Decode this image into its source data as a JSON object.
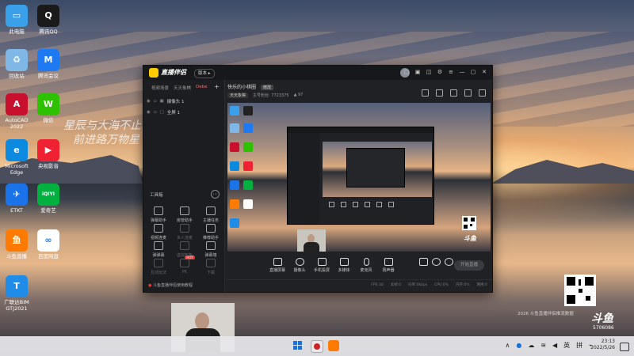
{
  "desktop": {
    "icons": [
      {
        "label": "此电脑",
        "glyph": "▭",
        "color": "#3aa0ea"
      },
      {
        "label": "腾讯QQ",
        "glyph": "Q",
        "color": "#1a1a1a"
      },
      {
        "label": "回收站",
        "glyph": "♻",
        "color": "#7fb8e6"
      },
      {
        "label": "腾讯会议",
        "glyph": "M",
        "color": "#1e7af2"
      },
      {
        "label": "AutoCAD 2022",
        "glyph": "A",
        "color": "#c8102e"
      },
      {
        "label": "微信",
        "glyph": "W",
        "color": "#2dc100"
      },
      {
        "label": "Microsoft Edge",
        "glyph": "e",
        "color": "#0c8adf"
      },
      {
        "label": "央视影音",
        "glyph": "▶",
        "color": "#e23"
      },
      {
        "label": "ETKT",
        "glyph": "✈",
        "color": "#1a73e8"
      },
      {
        "label": "爱奇艺",
        "glyph": "iQIYI",
        "color": "#00b140"
      },
      {
        "label": "斗鱼直播",
        "glyph": "鱼",
        "color": "#ff7a00"
      },
      {
        "label": "百度网盘",
        "glyph": "∞",
        "color": "#ffffff"
      },
      {
        "label": "广联达BIM GTJ2021",
        "glyph": "T",
        "color": "#1f8de8"
      }
    ],
    "handwriting": [
      "星辰与大海不止，",
      "前进路万物星"
    ],
    "watermark": "2026 斗鱼直播伴侣推流数据",
    "room_number": "5706086",
    "brand": "斗鱼"
  },
  "app": {
    "title": "直播伴侣",
    "version_button": "版本 ▸",
    "left_tabs": [
      "视频场景",
      "天天象棋",
      "Debe"
    ],
    "scenes": [
      "摄像头 1",
      "全屏 1"
    ],
    "tools_heading": "工具箱",
    "tools": [
      {
        "label": "弹幕助手",
        "dim": false
      },
      {
        "label": "房管助手",
        "dim": false
      },
      {
        "label": "主播任务",
        "dim": false
      },
      {
        "label": "视频连麦",
        "dim": false
      },
      {
        "label": "多人连麦",
        "dim": true
      },
      {
        "label": "推荐助手",
        "dim": false
      },
      {
        "label": "弹弹幕",
        "dim": false
      },
      {
        "label": "虚拟形象",
        "dim": true
      },
      {
        "label": "弹幕墙",
        "dim": false
      },
      {
        "label": "互动玩法",
        "dim": true
      },
      {
        "label": "PK",
        "dim": true,
        "badge": "HOT"
      },
      {
        "label": "下载",
        "dim": true
      }
    ],
    "left_footer": "斗鱼直播伴侣使用教程",
    "room_title": "快乐的小棋圈",
    "room_badge": "修改",
    "room_category": "天天象棋",
    "room_id_label": "主号粉丝: 7723375",
    "room_heat": "▲ 97",
    "bottom_tools": [
      "直播屏幕",
      "摄像头",
      "手机投屏",
      "多媒体",
      "麦克风",
      "扬声器"
    ],
    "start_button": "开始直播",
    "status_items": [
      "FPS:30",
      "丢帧:0",
      "码率:0kbps",
      "CPU:0%",
      "内存:0%",
      "网络:0"
    ]
  },
  "taskbar": {
    "tray": [
      "∧",
      "英",
      "拼",
      "⌂"
    ],
    "time": "23:13",
    "date": "2022/5/26"
  }
}
